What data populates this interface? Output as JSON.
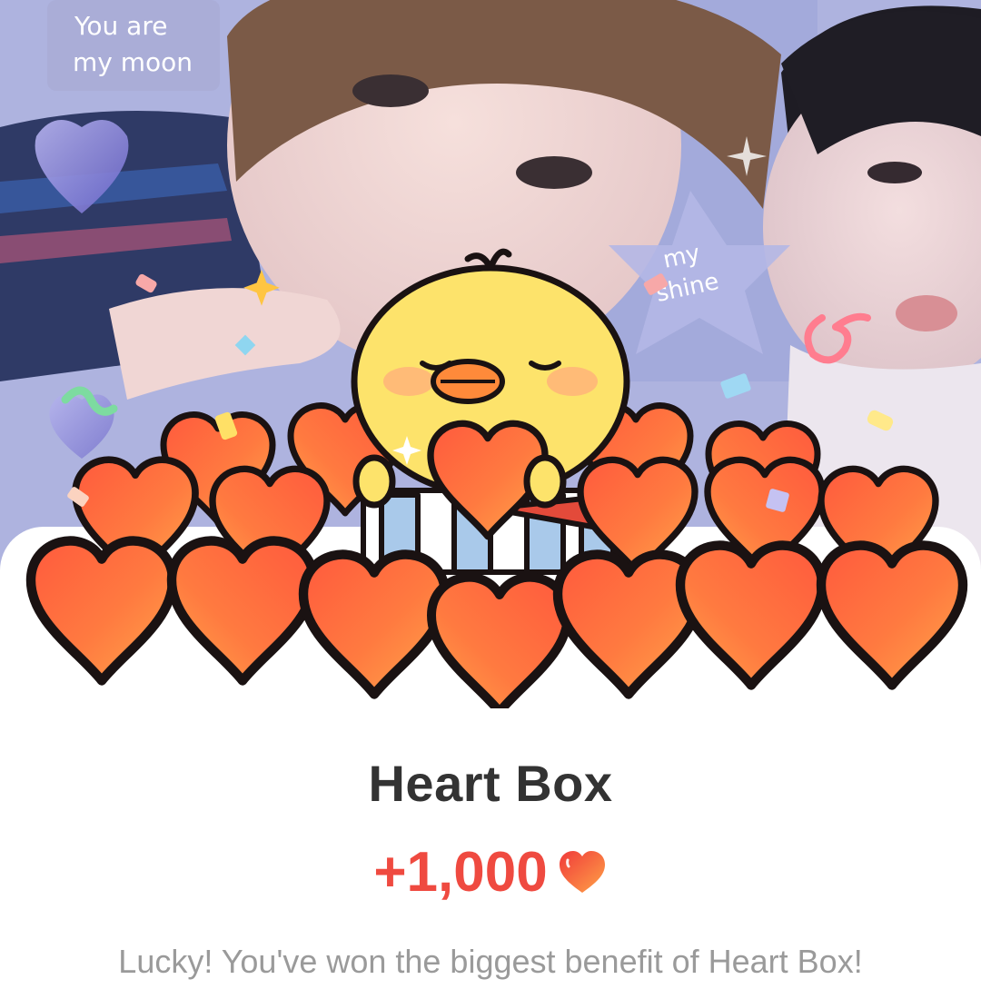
{
  "background": {
    "overlay_text_1": "You are",
    "overlay_text_2": "my moon",
    "overlay_text_3": "my",
    "overlay_text_4": "shine"
  },
  "reward": {
    "title": "Heart Box",
    "amount": "+1,000",
    "message": "Lucky! You've won the biggest benefit of Heart Box!"
  },
  "icons": {
    "reward_currency": "heart-icon"
  },
  "colors": {
    "title": "#333333",
    "amount": "#ef4a40",
    "message": "#9a9a9a",
    "heart_light": "#ffa347",
    "heart_dark": "#f03a3a",
    "chick": "#fde36b"
  }
}
